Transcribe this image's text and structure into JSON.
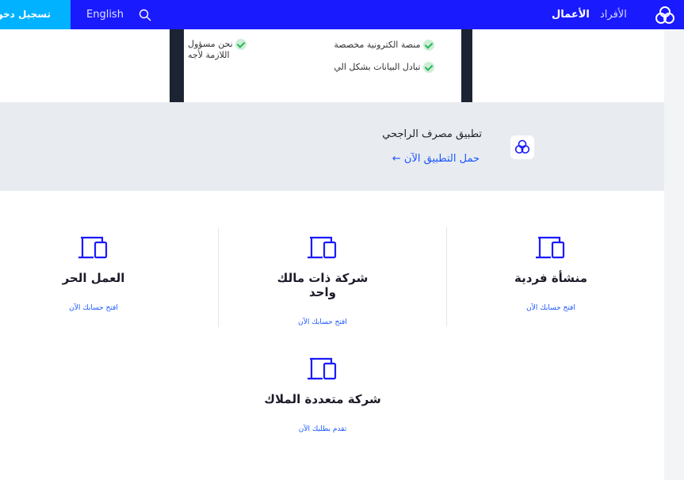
{
  "nav": {
    "login_label": "تسجيل دخول",
    "language_label": "English",
    "tab_business": "الأعمال",
    "tab_individuals": "الأفراد",
    "brand_color": "#1a1aff",
    "login_color": "#00b2ff"
  },
  "top_cards": {
    "left_card_lines": [
      "نحن مسؤول",
      "اللازمة لأجه"
    ],
    "middle_card_items": [
      "منصة الكترونية مخصصة",
      "تبادل البيانات بشكل الي"
    ]
  },
  "app_banner": {
    "title": "تطبيق مصرف الراجحي",
    "link": "حمل التطبيق الآن ←"
  },
  "account_types": [
    {
      "title": "منشأة فردية",
      "link": "افتح حسابك الآن"
    },
    {
      "title": "شركة ذات مالك واحد",
      "link": "افتح حسابك الآن"
    },
    {
      "title": "العمل الحر",
      "link": "افتح حسابك الآن"
    },
    {
      "title": "شركة متعددة الملاك",
      "link": "تقدم بطلبك الآن"
    }
  ]
}
